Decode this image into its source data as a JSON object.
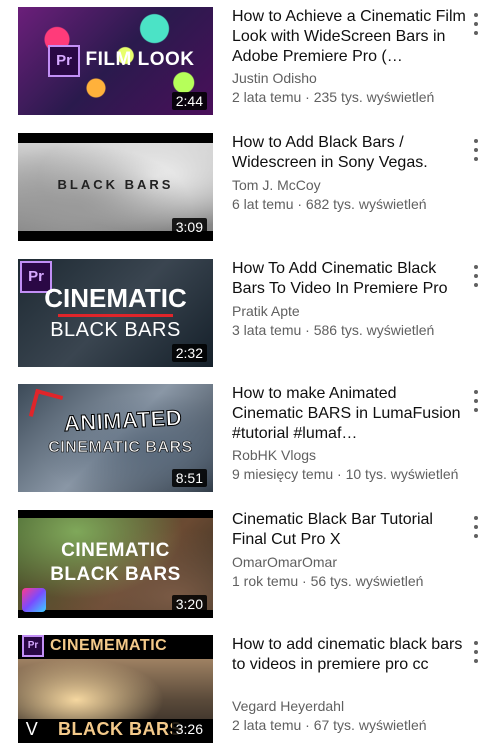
{
  "videos": [
    {
      "title": "How to Achieve a Cinematic Film Look with WideScreen Bars in Adobe Premiere Pro (…",
      "channel": "Justin Odisho",
      "meta": "2 lata temu · 235 tys. wyświetleń",
      "duration": "2:44",
      "thumb_text": "FILM LOOK",
      "thumb_logo": "Pr"
    },
    {
      "title": "How to Add Black Bars / Widescreen in Sony Vegas.",
      "channel": "Tom J. McCoy",
      "meta": "6 lat temu · 682 tys. wyświetleń",
      "duration": "3:09",
      "thumb_text": "BLACK BARS"
    },
    {
      "title": "How To Add Cinematic Black Bars To Video In Premiere Pro",
      "channel": "Pratik Apte",
      "meta": "3 lata temu · 586 tys. wyświetleń",
      "duration": "2:32",
      "thumb_text_1": "CINEMATIC",
      "thumb_text_2": "BLACK BARS",
      "thumb_logo": "Pr"
    },
    {
      "title": "How to make Animated Cinematic BARS in LumaFusion #tutorial #lumaf…",
      "channel": "RobHK Vlogs",
      "meta": "9 miesięcy temu · 10 tys. wyświetleń",
      "duration": "8:51",
      "thumb_text_1": "ANIMATED",
      "thumb_text_2": "CINEMATIC BARS"
    },
    {
      "title": "Cinematic Black Bar Tutorial Final Cut Pro X",
      "channel": "OmarOmarOmar",
      "meta": "1 rok temu · 56 tys. wyświetleń",
      "duration": "3:20",
      "thumb_text_1": "CINEMATIC",
      "thumb_text_2": "BLACK BARS"
    },
    {
      "title": "How to add cinematic black bars to videos in premiere pro cc",
      "channel": "Vegard Heyerdahl",
      "meta": "2 lata temu · 67 tys. wyświetleń",
      "duration": "3:26",
      "thumb_text_1": "CINEMEMATIC",
      "thumb_text_2": "BLACK BARS",
      "thumb_logo": "Pr"
    }
  ]
}
